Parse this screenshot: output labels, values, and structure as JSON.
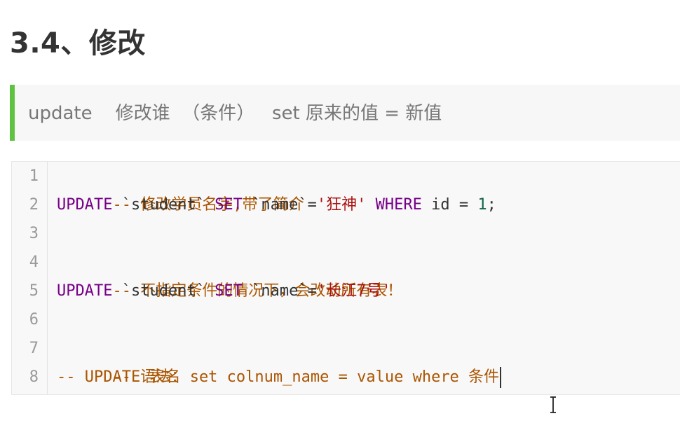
{
  "heading": "3.4、修改",
  "quote": {
    "text": "update    修改谁  （条件）   set 原来的值 = 新值"
  },
  "code": {
    "line_numbers": [
      "1",
      "2",
      "3",
      "4",
      "5",
      "6",
      "7",
      "8"
    ],
    "lines": {
      "l1": {
        "comment": "-- 修改学员名字,带了简介"
      },
      "l2": {
        "kw1": "UPDATE",
        "sp1": " `student` ",
        "kw2": "SET",
        "sp2": " `name`=",
        "str": "'狂神'",
        "sp3": " ",
        "kw3": "WHERE",
        "sp4": " id = ",
        "num": "1",
        "end": ";"
      },
      "l4": {
        "comment": "-- 不指定条件的情况下，会改动所有表！"
      },
      "l5": {
        "kw1": "UPDATE",
        "sp1": " `student` ",
        "kw2": "SET",
        "sp2": " `name`=",
        "str": "'长江7号'"
      },
      "l7": {
        "comment": "-- 语法："
      },
      "l8": {
        "comment": "-- UPDATE 表名 set colnum_name = value where 条件"
      }
    }
  },
  "colors": {
    "accent_border": "#5fc241",
    "keyword": "#770088",
    "comment": "#aa5500",
    "string": "#aa1111",
    "number": "#116644"
  }
}
